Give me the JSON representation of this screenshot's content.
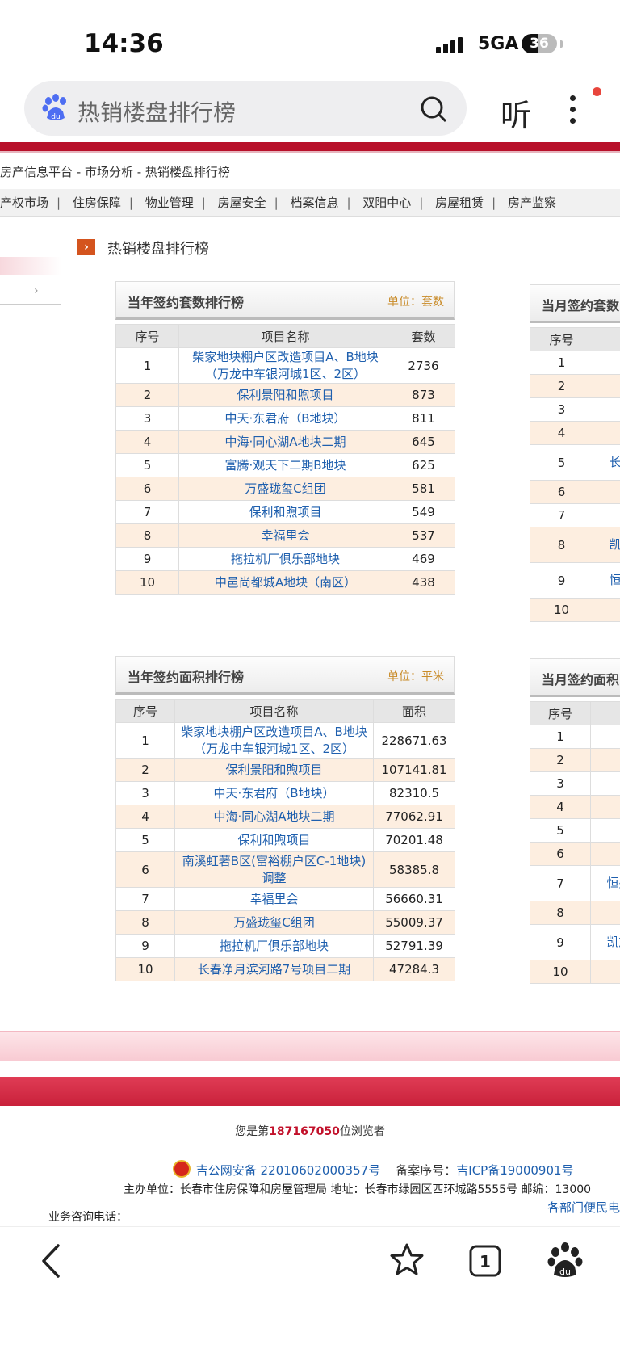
{
  "status": {
    "time": "14:36",
    "network": "5GA",
    "battery": "36"
  },
  "search": {
    "query": "热销楼盘排行榜",
    "listen_label": "听"
  },
  "breadcrumb": "房产信息平台 - 市场分析 - 热销楼盘排行榜",
  "nav": [
    "产权市场",
    "住房保障",
    "物业管理",
    "房屋安全",
    "档案信息",
    "双阳中心",
    "房屋租赁",
    "房产监察"
  ],
  "section_title": "热销楼盘排行榜",
  "year_count": {
    "title": "当年签约套数排行榜",
    "unit": "单位：套数",
    "headers": [
      "序号",
      "项目名称",
      "套数"
    ],
    "rows": [
      [
        "1",
        "柴家地块棚户区改造项目A、B地块（万龙中车银河城1区、2区）",
        "2736"
      ],
      [
        "2",
        "保利景阳和煦项目",
        "873"
      ],
      [
        "3",
        "中天·东君府（B地块）",
        "811"
      ],
      [
        "4",
        "中海·同心湖A地块二期",
        "645"
      ],
      [
        "5",
        "富腾·观天下二期B地块",
        "625"
      ],
      [
        "6",
        "万盛珑玺C组团",
        "581"
      ],
      [
        "7",
        "保利和煦项目",
        "549"
      ],
      [
        "8",
        "幸福里会",
        "537"
      ],
      [
        "9",
        "拖拉机厂俱乐部地块",
        "469"
      ],
      [
        "10",
        "中邑尚都城A地块（南区）",
        "438"
      ]
    ]
  },
  "year_area": {
    "title": "当年签约面积排行榜",
    "unit": "单位：平米",
    "headers": [
      "序号",
      "项目名称",
      "面积"
    ],
    "rows": [
      [
        "1",
        "柴家地块棚户区改造项目A、B地块（万龙中车银河城1区、2区）",
        "228671.63"
      ],
      [
        "2",
        "保利景阳和煦项目",
        "107141.81"
      ],
      [
        "3",
        "中天·东君府（B地块）",
        "82310.5"
      ],
      [
        "4",
        "中海·同心湖A地块二期",
        "77062.91"
      ],
      [
        "5",
        "保利和煦项目",
        "70201.48"
      ],
      [
        "6",
        "南溪虹著B区(富裕棚户区C-1地块)调整",
        "58385.8"
      ],
      [
        "7",
        "幸福里会",
        "56660.31"
      ],
      [
        "8",
        "万盛珑玺C组团",
        "55009.37"
      ],
      [
        "9",
        "拖拉机厂俱乐部地块",
        "52791.39"
      ],
      [
        "10",
        "长春净月滨河路7号项目二期",
        "47284.3"
      ]
    ]
  },
  "month_count": {
    "title": "当月签约套数",
    "headers": [
      "序号",
      ""
    ],
    "rows": [
      [
        "1",
        ""
      ],
      [
        "2",
        ""
      ],
      [
        "3",
        ""
      ],
      [
        "4",
        ""
      ],
      [
        "5",
        "长春"
      ],
      [
        "6",
        ""
      ],
      [
        "7",
        ""
      ],
      [
        "8",
        "凯旋"
      ],
      [
        "9",
        "恒盛"
      ],
      [
        "10",
        ""
      ]
    ]
  },
  "month_area": {
    "title": "当月签约面积",
    "headers": [
      "序号",
      ""
    ],
    "rows": [
      [
        "1",
        ""
      ],
      [
        "2",
        ""
      ],
      [
        "3",
        ""
      ],
      [
        "4",
        ""
      ],
      [
        "5",
        ""
      ],
      [
        "6",
        ""
      ],
      [
        "7",
        "恒盛"
      ],
      [
        "8",
        ""
      ],
      [
        "9",
        "凯旋"
      ],
      [
        "10",
        ""
      ]
    ]
  },
  "footer": {
    "visitor_prefix": "您是第",
    "visitor_count": "187167050",
    "visitor_suffix": "位浏览者",
    "police_record": "吉公网安备 22010602000357号",
    "icp_label": "备案序号：",
    "icp_link": "吉ICP备19000901号",
    "host": "主办单位：长春市住房保障和房屋管理局 地址：长春市绿园区西环城路5555号 邮编：13000",
    "phone_label": "业务咨询电话：",
    "dept_link": "各部门便民电"
  },
  "bottom_nav": {
    "tab_count": "1"
  },
  "colors": {
    "accent_red": "#b8102a",
    "link_blue": "#1e5fae",
    "unit_orange": "#c98c2a",
    "row_alt": "#fdeee0"
  }
}
